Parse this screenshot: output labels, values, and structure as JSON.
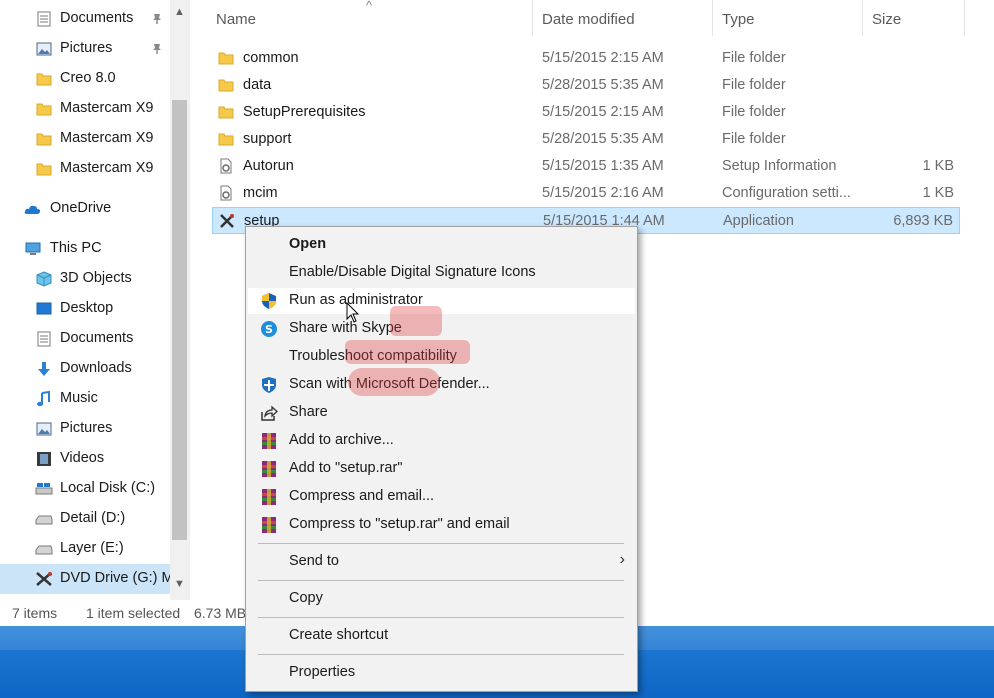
{
  "nav": {
    "items": [
      {
        "label": "Documents",
        "icon": "documents-icon",
        "pinned": true
      },
      {
        "label": "Pictures",
        "icon": "pictures-icon",
        "pinned": true
      },
      {
        "label": "Creo 8.0",
        "icon": "folder-icon"
      },
      {
        "label": "Mastercam X9",
        "icon": "folder-icon"
      },
      {
        "label": "Mastercam X9",
        "icon": "folder-icon"
      },
      {
        "label": "Mastercam X9",
        "icon": "folder-icon"
      },
      {
        "label": "OneDrive",
        "icon": "onedrive-icon"
      },
      {
        "label": "This PC",
        "icon": "this-pc-icon"
      },
      {
        "label": "3D Objects",
        "icon": "3d-objects-icon"
      },
      {
        "label": "Desktop",
        "icon": "desktop-icon"
      },
      {
        "label": "Documents",
        "icon": "documents-icon"
      },
      {
        "label": "Downloads",
        "icon": "downloads-icon"
      },
      {
        "label": "Music",
        "icon": "music-icon"
      },
      {
        "label": "Pictures",
        "icon": "pictures-icon"
      },
      {
        "label": "Videos",
        "icon": "videos-icon"
      },
      {
        "label": "Local Disk (C:)",
        "icon": "local-disk-icon"
      },
      {
        "label": "Detail (D:)",
        "icon": "drive-icon"
      },
      {
        "label": "Layer (E:)",
        "icon": "drive-icon"
      },
      {
        "label": "DVD Drive (G:) M",
        "icon": "dvd-drive-icon",
        "selected": true
      }
    ]
  },
  "columns": {
    "name": "Name",
    "date": "Date modified",
    "type": "Type",
    "size": "Size"
  },
  "files": [
    {
      "name": "common",
      "date": "5/15/2015 2:15 AM",
      "type": "File folder",
      "size": "",
      "icon": "folder-icon"
    },
    {
      "name": "data",
      "date": "5/28/2015 5:35 AM",
      "type": "File folder",
      "size": "",
      "icon": "folder-icon"
    },
    {
      "name": "SetupPrerequisites",
      "date": "5/15/2015 2:15 AM",
      "type": "File folder",
      "size": "",
      "icon": "folder-icon"
    },
    {
      "name": "support",
      "date": "5/28/2015 5:35 AM",
      "type": "File folder",
      "size": "",
      "icon": "folder-icon"
    },
    {
      "name": "Autorun",
      "date": "5/15/2015 1:35 AM",
      "type": "Setup Information",
      "size": "1 KB",
      "icon": "setup-info-icon"
    },
    {
      "name": "mcim",
      "date": "5/15/2015 2:16 AM",
      "type": "Configuration setti...",
      "size": "1 KB",
      "icon": "config-icon"
    },
    {
      "name": "setup",
      "date": "5/15/2015 1:44 AM",
      "type": "Application",
      "size": "6,893 KB",
      "icon": "mastercam-app-icon",
      "selected": true
    }
  ],
  "status": {
    "count": "7 items",
    "selected": "1 item selected",
    "size": "6.73 MB"
  },
  "context_menu": {
    "open": "Open",
    "sig_icons": "Enable/Disable Digital Signature Icons",
    "run_admin": "Run as administrator",
    "skype": "Share with Skype",
    "troubleshoot": "Troubleshoot compatibility",
    "defender": "Scan with Microsoft Defender...",
    "share": "Share",
    "add_archive": "Add to archive...",
    "add_rar": "Add to \"setup.rar\"",
    "compress_email": "Compress and email...",
    "compress_rar_email": "Compress to \"setup.rar\" and email",
    "send_to": "Send to",
    "copy": "Copy",
    "create_shortcut": "Create shortcut",
    "properties": "Properties"
  },
  "colors": {
    "selection": "#cce8ff",
    "nav_selection": "#cce4f7",
    "taskbar": "#1a74cf",
    "menu_bg": "#f2f2f2"
  }
}
